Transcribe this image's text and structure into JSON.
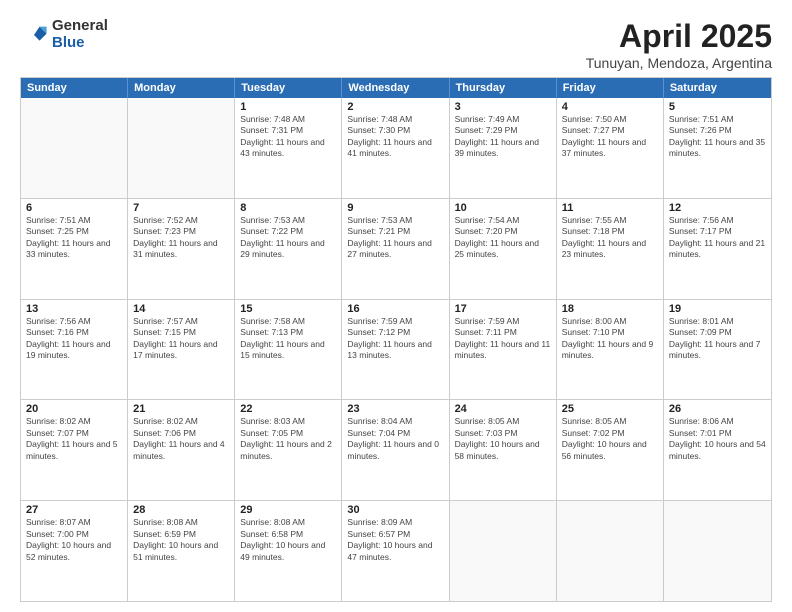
{
  "logo": {
    "general": "General",
    "blue": "Blue"
  },
  "title": {
    "month": "April 2025",
    "location": "Tunuyan, Mendoza, Argentina"
  },
  "header": {
    "days": [
      "Sunday",
      "Monday",
      "Tuesday",
      "Wednesday",
      "Thursday",
      "Friday",
      "Saturday"
    ]
  },
  "weeks": [
    [
      {
        "day": "",
        "empty": true
      },
      {
        "day": "",
        "empty": true
      },
      {
        "day": "1",
        "sunrise": "Sunrise: 7:48 AM",
        "sunset": "Sunset: 7:31 PM",
        "daylight": "Daylight: 11 hours and 43 minutes."
      },
      {
        "day": "2",
        "sunrise": "Sunrise: 7:48 AM",
        "sunset": "Sunset: 7:30 PM",
        "daylight": "Daylight: 11 hours and 41 minutes."
      },
      {
        "day": "3",
        "sunrise": "Sunrise: 7:49 AM",
        "sunset": "Sunset: 7:29 PM",
        "daylight": "Daylight: 11 hours and 39 minutes."
      },
      {
        "day": "4",
        "sunrise": "Sunrise: 7:50 AM",
        "sunset": "Sunset: 7:27 PM",
        "daylight": "Daylight: 11 hours and 37 minutes."
      },
      {
        "day": "5",
        "sunrise": "Sunrise: 7:51 AM",
        "sunset": "Sunset: 7:26 PM",
        "daylight": "Daylight: 11 hours and 35 minutes."
      }
    ],
    [
      {
        "day": "6",
        "sunrise": "Sunrise: 7:51 AM",
        "sunset": "Sunset: 7:25 PM",
        "daylight": "Daylight: 11 hours and 33 minutes."
      },
      {
        "day": "7",
        "sunrise": "Sunrise: 7:52 AM",
        "sunset": "Sunset: 7:23 PM",
        "daylight": "Daylight: 11 hours and 31 minutes."
      },
      {
        "day": "8",
        "sunrise": "Sunrise: 7:53 AM",
        "sunset": "Sunset: 7:22 PM",
        "daylight": "Daylight: 11 hours and 29 minutes."
      },
      {
        "day": "9",
        "sunrise": "Sunrise: 7:53 AM",
        "sunset": "Sunset: 7:21 PM",
        "daylight": "Daylight: 11 hours and 27 minutes."
      },
      {
        "day": "10",
        "sunrise": "Sunrise: 7:54 AM",
        "sunset": "Sunset: 7:20 PM",
        "daylight": "Daylight: 11 hours and 25 minutes."
      },
      {
        "day": "11",
        "sunrise": "Sunrise: 7:55 AM",
        "sunset": "Sunset: 7:18 PM",
        "daylight": "Daylight: 11 hours and 23 minutes."
      },
      {
        "day": "12",
        "sunrise": "Sunrise: 7:56 AM",
        "sunset": "Sunset: 7:17 PM",
        "daylight": "Daylight: 11 hours and 21 minutes."
      }
    ],
    [
      {
        "day": "13",
        "sunrise": "Sunrise: 7:56 AM",
        "sunset": "Sunset: 7:16 PM",
        "daylight": "Daylight: 11 hours and 19 minutes."
      },
      {
        "day": "14",
        "sunrise": "Sunrise: 7:57 AM",
        "sunset": "Sunset: 7:15 PM",
        "daylight": "Daylight: 11 hours and 17 minutes."
      },
      {
        "day": "15",
        "sunrise": "Sunrise: 7:58 AM",
        "sunset": "Sunset: 7:13 PM",
        "daylight": "Daylight: 11 hours and 15 minutes."
      },
      {
        "day": "16",
        "sunrise": "Sunrise: 7:59 AM",
        "sunset": "Sunset: 7:12 PM",
        "daylight": "Daylight: 11 hours and 13 minutes."
      },
      {
        "day": "17",
        "sunrise": "Sunrise: 7:59 AM",
        "sunset": "Sunset: 7:11 PM",
        "daylight": "Daylight: 11 hours and 11 minutes."
      },
      {
        "day": "18",
        "sunrise": "Sunrise: 8:00 AM",
        "sunset": "Sunset: 7:10 PM",
        "daylight": "Daylight: 11 hours and 9 minutes."
      },
      {
        "day": "19",
        "sunrise": "Sunrise: 8:01 AM",
        "sunset": "Sunset: 7:09 PM",
        "daylight": "Daylight: 11 hours and 7 minutes."
      }
    ],
    [
      {
        "day": "20",
        "sunrise": "Sunrise: 8:02 AM",
        "sunset": "Sunset: 7:07 PM",
        "daylight": "Daylight: 11 hours and 5 minutes."
      },
      {
        "day": "21",
        "sunrise": "Sunrise: 8:02 AM",
        "sunset": "Sunset: 7:06 PM",
        "daylight": "Daylight: 11 hours and 4 minutes."
      },
      {
        "day": "22",
        "sunrise": "Sunrise: 8:03 AM",
        "sunset": "Sunset: 7:05 PM",
        "daylight": "Daylight: 11 hours and 2 minutes."
      },
      {
        "day": "23",
        "sunrise": "Sunrise: 8:04 AM",
        "sunset": "Sunset: 7:04 PM",
        "daylight": "Daylight: 11 hours and 0 minutes."
      },
      {
        "day": "24",
        "sunrise": "Sunrise: 8:05 AM",
        "sunset": "Sunset: 7:03 PM",
        "daylight": "Daylight: 10 hours and 58 minutes."
      },
      {
        "day": "25",
        "sunrise": "Sunrise: 8:05 AM",
        "sunset": "Sunset: 7:02 PM",
        "daylight": "Daylight: 10 hours and 56 minutes."
      },
      {
        "day": "26",
        "sunrise": "Sunrise: 8:06 AM",
        "sunset": "Sunset: 7:01 PM",
        "daylight": "Daylight: 10 hours and 54 minutes."
      }
    ],
    [
      {
        "day": "27",
        "sunrise": "Sunrise: 8:07 AM",
        "sunset": "Sunset: 7:00 PM",
        "daylight": "Daylight: 10 hours and 52 minutes."
      },
      {
        "day": "28",
        "sunrise": "Sunrise: 8:08 AM",
        "sunset": "Sunset: 6:59 PM",
        "daylight": "Daylight: 10 hours and 51 minutes."
      },
      {
        "day": "29",
        "sunrise": "Sunrise: 8:08 AM",
        "sunset": "Sunset: 6:58 PM",
        "daylight": "Daylight: 10 hours and 49 minutes."
      },
      {
        "day": "30",
        "sunrise": "Sunrise: 8:09 AM",
        "sunset": "Sunset: 6:57 PM",
        "daylight": "Daylight: 10 hours and 47 minutes."
      },
      {
        "day": "",
        "empty": true
      },
      {
        "day": "",
        "empty": true
      },
      {
        "day": "",
        "empty": true
      }
    ]
  ]
}
